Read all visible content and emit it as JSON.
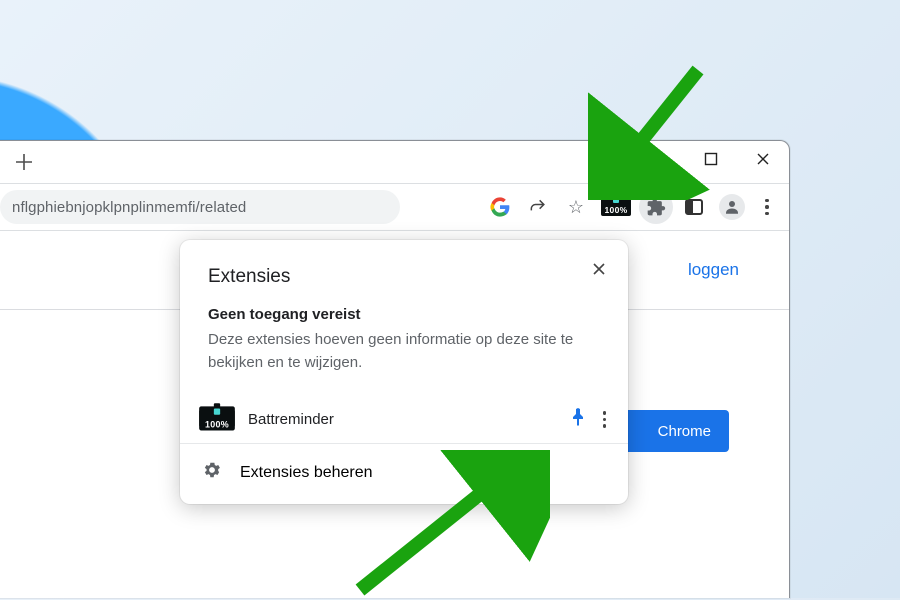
{
  "address_bar": {
    "text": "nflgphiebnjopklpnplinmemfi/related"
  },
  "toolbar": {
    "battery_percent": "100%",
    "icons": {
      "google": "google-icon",
      "share": "share-icon",
      "star": "bookmark-star-icon",
      "battery_ext": "battreminder-icon",
      "extensions": "puzzle-icon",
      "sidepanel": "sidepanel-icon",
      "profile": "profile-icon",
      "menu": "kebab-menu-icon"
    }
  },
  "window_controls": {
    "minimize": "—",
    "maximize": "□",
    "close": "✕"
  },
  "page": {
    "header_link": "loggen",
    "cta_button": "Chrome"
  },
  "popup": {
    "title": "Extensies",
    "section_title": "Geen toegang vereist",
    "section_desc": "Deze extensies hoeven geen informatie op deze site te bekijken en te wijzigen.",
    "extension": {
      "name": "Battreminder",
      "battery_percent": "100%"
    },
    "manage_label": "Extensies beheren"
  }
}
